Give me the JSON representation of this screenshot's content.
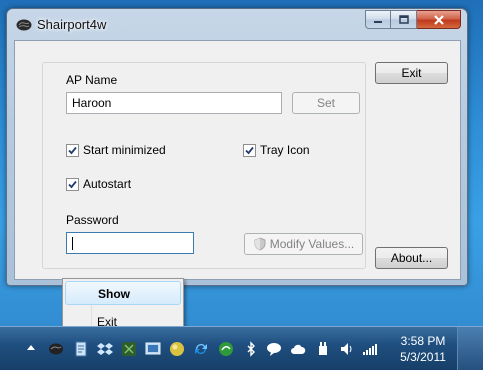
{
  "window": {
    "title": "Shairport4w",
    "ap_name_label": "AP Name",
    "ap_name_value": "Haroon",
    "set_button": "Set",
    "exit_button": "Exit",
    "about_button": "About...",
    "start_minimized_label": "Start minimized",
    "start_minimized_checked": true,
    "tray_icon_label": "Tray Icon",
    "tray_icon_checked": true,
    "autostart_label": "Autostart",
    "autostart_checked": true,
    "password_label": "Password",
    "password_value": "",
    "modify_values_button": "Modify Values..."
  },
  "context_menu": {
    "items": [
      {
        "label": "Show",
        "highlighted": true
      },
      {
        "label": "Exit",
        "highlighted": false
      }
    ]
  },
  "taskbar": {
    "time": "3:58 PM",
    "date": "5/3/2011",
    "tray_icons": [
      "shairport-icon",
      "notes-icon",
      "dropbox-icon",
      "evernote-icon",
      "display-icon",
      "ball-icon",
      "sync-icon",
      "green-icon",
      "bluetooth-icon",
      "chat-icon",
      "cloud-icon",
      "power-icon",
      "volume-icon",
      "signal-icon"
    ]
  },
  "colors": {
    "taskbar": "#1f4f80",
    "desktop": "#2f8fd8",
    "menu_highlight": "#d5ebfb"
  }
}
